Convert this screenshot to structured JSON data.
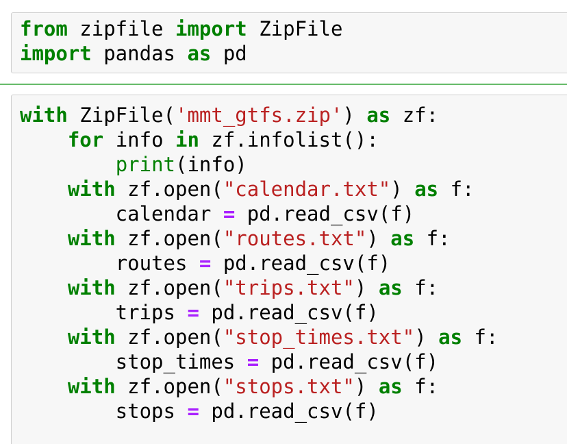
{
  "cells": [
    {
      "lines": [
        [
          {
            "t": "from",
            "c": "kw"
          },
          {
            "t": " zipfile ",
            "c": ""
          },
          {
            "t": "import",
            "c": "kw"
          },
          {
            "t": " ZipFile",
            "c": ""
          }
        ],
        [
          {
            "t": "import",
            "c": "kw"
          },
          {
            "t": " pandas ",
            "c": ""
          },
          {
            "t": "as",
            "c": "kw"
          },
          {
            "t": " pd",
            "c": ""
          }
        ]
      ]
    },
    {
      "lines": [
        [
          {
            "t": "with",
            "c": "kw"
          },
          {
            "t": " ZipFile(",
            "c": ""
          },
          {
            "t": "'mmt_gtfs.zip'",
            "c": "st"
          },
          {
            "t": ") ",
            "c": ""
          },
          {
            "t": "as",
            "c": "kw"
          },
          {
            "t": " zf:",
            "c": ""
          }
        ],
        [
          {
            "t": "    ",
            "c": ""
          },
          {
            "t": "for",
            "c": "kw"
          },
          {
            "t": " info ",
            "c": ""
          },
          {
            "t": "in",
            "c": "kw"
          },
          {
            "t": " zf.infolist():",
            "c": ""
          }
        ],
        [
          {
            "t": "        ",
            "c": ""
          },
          {
            "t": "print",
            "c": "bi"
          },
          {
            "t": "(info)",
            "c": ""
          }
        ],
        [
          {
            "t": "    ",
            "c": ""
          },
          {
            "t": "with",
            "c": "kw"
          },
          {
            "t": " zf.open(",
            "c": ""
          },
          {
            "t": "\"calendar.txt\"",
            "c": "st"
          },
          {
            "t": ") ",
            "c": ""
          },
          {
            "t": "as",
            "c": "kw"
          },
          {
            "t": " f:",
            "c": ""
          }
        ],
        [
          {
            "t": "        calendar ",
            "c": ""
          },
          {
            "t": "=",
            "c": "op"
          },
          {
            "t": " pd.read_csv(f)",
            "c": ""
          }
        ],
        [
          {
            "t": "    ",
            "c": ""
          },
          {
            "t": "with",
            "c": "kw"
          },
          {
            "t": " zf.open(",
            "c": ""
          },
          {
            "t": "\"routes.txt\"",
            "c": "st"
          },
          {
            "t": ") ",
            "c": ""
          },
          {
            "t": "as",
            "c": "kw"
          },
          {
            "t": " f:",
            "c": ""
          }
        ],
        [
          {
            "t": "        routes ",
            "c": ""
          },
          {
            "t": "=",
            "c": "op"
          },
          {
            "t": " pd.read_csv(f)",
            "c": ""
          }
        ],
        [
          {
            "t": "    ",
            "c": ""
          },
          {
            "t": "with",
            "c": "kw"
          },
          {
            "t": " zf.open(",
            "c": ""
          },
          {
            "t": "\"trips.txt\"",
            "c": "st"
          },
          {
            "t": ") ",
            "c": ""
          },
          {
            "t": "as",
            "c": "kw"
          },
          {
            "t": " f:",
            "c": ""
          }
        ],
        [
          {
            "t": "        trips ",
            "c": ""
          },
          {
            "t": "=",
            "c": "op"
          },
          {
            "t": " pd.read_csv(f)",
            "c": ""
          }
        ],
        [
          {
            "t": "    ",
            "c": ""
          },
          {
            "t": "with",
            "c": "kw"
          },
          {
            "t": " zf.open(",
            "c": ""
          },
          {
            "t": "\"stop_times.txt\"",
            "c": "st"
          },
          {
            "t": ") ",
            "c": ""
          },
          {
            "t": "as",
            "c": "kw"
          },
          {
            "t": " f:",
            "c": ""
          }
        ],
        [
          {
            "t": "        stop_times ",
            "c": ""
          },
          {
            "t": "=",
            "c": "op"
          },
          {
            "t": " pd.read_csv(f)",
            "c": ""
          }
        ],
        [
          {
            "t": "    ",
            "c": ""
          },
          {
            "t": "with",
            "c": "kw"
          },
          {
            "t": " zf.open(",
            "c": ""
          },
          {
            "t": "\"stops.txt\"",
            "c": "st"
          },
          {
            "t": ") ",
            "c": ""
          },
          {
            "t": "as",
            "c": "kw"
          },
          {
            "t": " f:",
            "c": ""
          }
        ],
        [
          {
            "t": "        stops ",
            "c": ""
          },
          {
            "t": "=",
            "c": "op"
          },
          {
            "t": " pd.read_csv(f)",
            "c": ""
          }
        ]
      ]
    }
  ],
  "colors": {
    "keyword": "#008000",
    "builtin": "#008000",
    "string": "#ba2121",
    "operator": "#aa22ff",
    "cell_background": "#f7f7f7",
    "cell_border": "#cfcfcf",
    "selection_bar": "#66bb6a"
  }
}
